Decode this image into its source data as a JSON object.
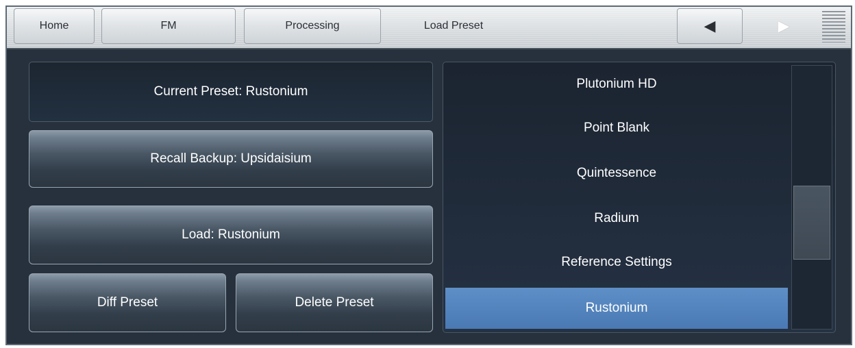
{
  "nav": {
    "tabs": [
      "Home",
      "FM",
      "Processing"
    ],
    "current_page": "Load Preset",
    "prev_icon": "left-triangle-icon",
    "next_icon": "right-triangle-icon",
    "menu_icon": "menu-lines-icon"
  },
  "left": {
    "current_preset": "Current Preset: Rustonium",
    "recall_backup": "Recall Backup: Upsidaisium",
    "load": "Load: Rustonium",
    "diff": "Diff Preset",
    "delete": "Delete Preset"
  },
  "list": {
    "items": [
      "Plutonium HD",
      "Point Blank",
      "Quintessence",
      "Radium",
      "Reference Settings",
      "Rustonium"
    ],
    "selected": "Rustonium"
  },
  "colors": {
    "selected_item": "#5a8cc5",
    "panel_bg": "#26313d"
  }
}
